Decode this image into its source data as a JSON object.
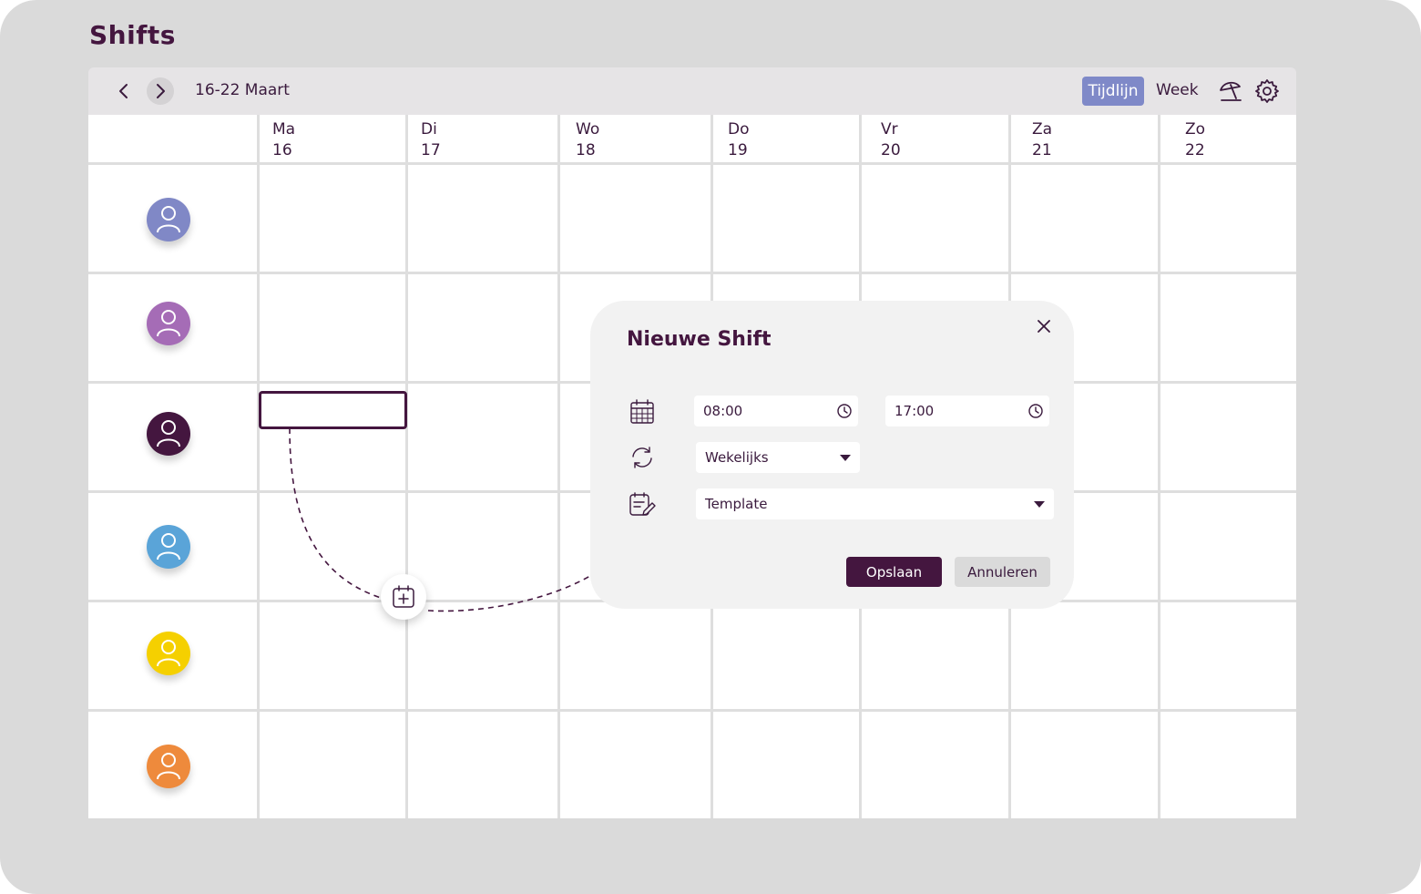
{
  "page": {
    "title": "Shifts"
  },
  "toolbar": {
    "prev_icon": "chevron-left-icon",
    "next_icon": "chevron-right-icon",
    "date_range": "16-22 Maart",
    "views": [
      "Tijdlijn",
      "Week"
    ],
    "active_view": "Tijdlijn",
    "vacation_icon": "beach-umbrella-icon",
    "settings_icon": "gear-icon",
    "accent_color": "#7f89c8"
  },
  "calendar": {
    "days": [
      {
        "name": "Ma",
        "date": "16"
      },
      {
        "name": "Di",
        "date": "17"
      },
      {
        "name": "Wo",
        "date": "18"
      },
      {
        "name": "Do",
        "date": "19"
      },
      {
        "name": "Vr",
        "date": "20"
      },
      {
        "name": "Za",
        "date": "21"
      },
      {
        "name": "Zo",
        "date": "22"
      }
    ],
    "employees": [
      {
        "avatar_icon": "user-icon",
        "color": "#8088c6"
      },
      {
        "avatar_icon": "user-icon",
        "color": "#a56cb6"
      },
      {
        "avatar_icon": "user-icon",
        "color": "#44163f"
      },
      {
        "avatar_icon": "user-icon",
        "color": "#5aa4d8"
      },
      {
        "avatar_icon": "user-icon",
        "color": "#f5d000"
      },
      {
        "avatar_icon": "user-icon",
        "color": "#ee8a3c"
      }
    ],
    "add_shift_icon": "calendar-plus-icon"
  },
  "modal": {
    "title": "Nieuwe Shift",
    "close_icon": "close-icon",
    "date_icon": "calendar-icon",
    "start_time": "08:00",
    "end_time": "17:00",
    "clock_icon": "clock-icon",
    "repeat_icon": "repeat-icon",
    "repeat_value": "Wekelijks",
    "template_icon": "edit-note-icon",
    "template_value": "Template",
    "save_label": "Opslaan",
    "cancel_label": "Annuleren",
    "primary_color": "#44163f"
  }
}
